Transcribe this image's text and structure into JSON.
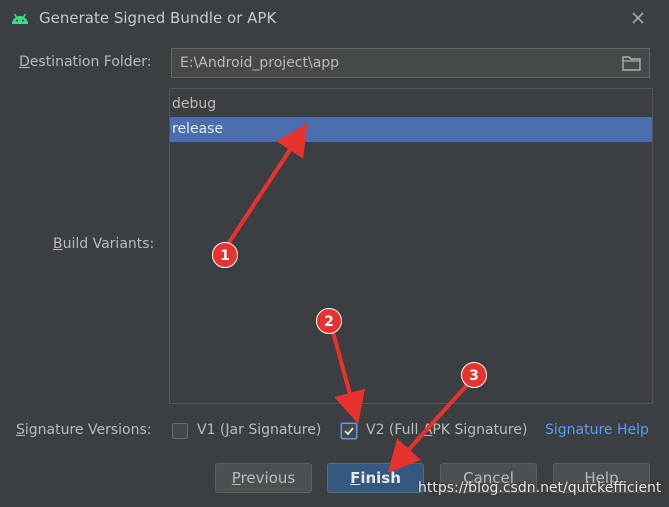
{
  "window": {
    "title": "Generate Signed Bundle or APK",
    "app_icon": "android-icon",
    "close_icon": "close-icon"
  },
  "destination": {
    "label": "Destination Folder:",
    "mnemonic": "D",
    "label_rest": "estination Folder:",
    "value": "E:\\Android_project\\app",
    "folder_icon": "folder-icon"
  },
  "build_variants": {
    "label": "Build Variants:",
    "mnemonic": "B",
    "label_rest": "uild Variants:",
    "items": [
      {
        "label": "debug",
        "selected": false
      },
      {
        "label": "release",
        "selected": true
      }
    ],
    "selection_color": "#4b6eaf"
  },
  "signature": {
    "label": "Signature Versions:",
    "mnemonic": "S",
    "label_rest": "ignature Versions:",
    "v1": {
      "label": "V1 (Jar Signature)",
      "pre": "V1 (",
      "mnemonic": "J",
      "post": "ar Signature)",
      "checked": false
    },
    "v2": {
      "label": "V2 (Full APK Signature)",
      "pre": "V2 (Full ",
      "mnemonic": "A",
      "post": "PK Signature)",
      "checked": true
    },
    "help_link": "Signature Help"
  },
  "buttons": {
    "previous": {
      "label": "Previous",
      "mnemonic": "P",
      "rest": "revious"
    },
    "finish": {
      "label": "Finish",
      "mnemonic": "F",
      "rest": "inish"
    },
    "cancel": {
      "label": "Cancel",
      "mnemonic": "C",
      "rest": "ancel"
    },
    "help": {
      "label": "Help",
      "mnemonic": "H",
      "rest": "elp"
    }
  },
  "annotations": {
    "badges": [
      "1",
      "2",
      "3"
    ],
    "color": "#e8322e"
  },
  "watermark": "https://blog.csdn.net/quickefficient",
  "colors": {
    "background": "#3c3f41",
    "accent": "#365880",
    "link": "#589df6"
  }
}
